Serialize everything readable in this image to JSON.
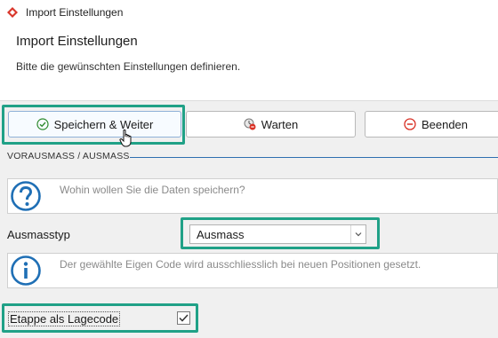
{
  "window": {
    "title": "Import Einstellungen",
    "icon": "diamond-app-icon"
  },
  "header": {
    "title": "Import Einstellungen",
    "subtitle": "Bitte die gewünschten Einstellungen definieren."
  },
  "toolbar": {
    "save_label": "Speichern & Weiter",
    "save_icon": "check-circle-icon",
    "wait_label": "Warten",
    "wait_icon": "clock-stop-icon",
    "end_label": "Beenden",
    "end_icon": "minus-circle-icon"
  },
  "section": {
    "title": "VORAUSMASS / AUSMASS"
  },
  "question_panel": {
    "icon": "question-icon",
    "text": "Wohin wollen Sie die Daten speichern?"
  },
  "ausmasstyp": {
    "label": "Ausmasstyp",
    "value": "Ausmass"
  },
  "info_panel": {
    "icon": "info-icon",
    "text": "Der gewählte Eigen Code wird ausschliesslich bei neuen Positionen gesetzt."
  },
  "etappe": {
    "label": "Etappe als Lagecode",
    "checked": true
  },
  "colors": {
    "highlight": "#20a187",
    "accent_blue": "#1f6fb5",
    "section_line": "#2f6fb0"
  }
}
